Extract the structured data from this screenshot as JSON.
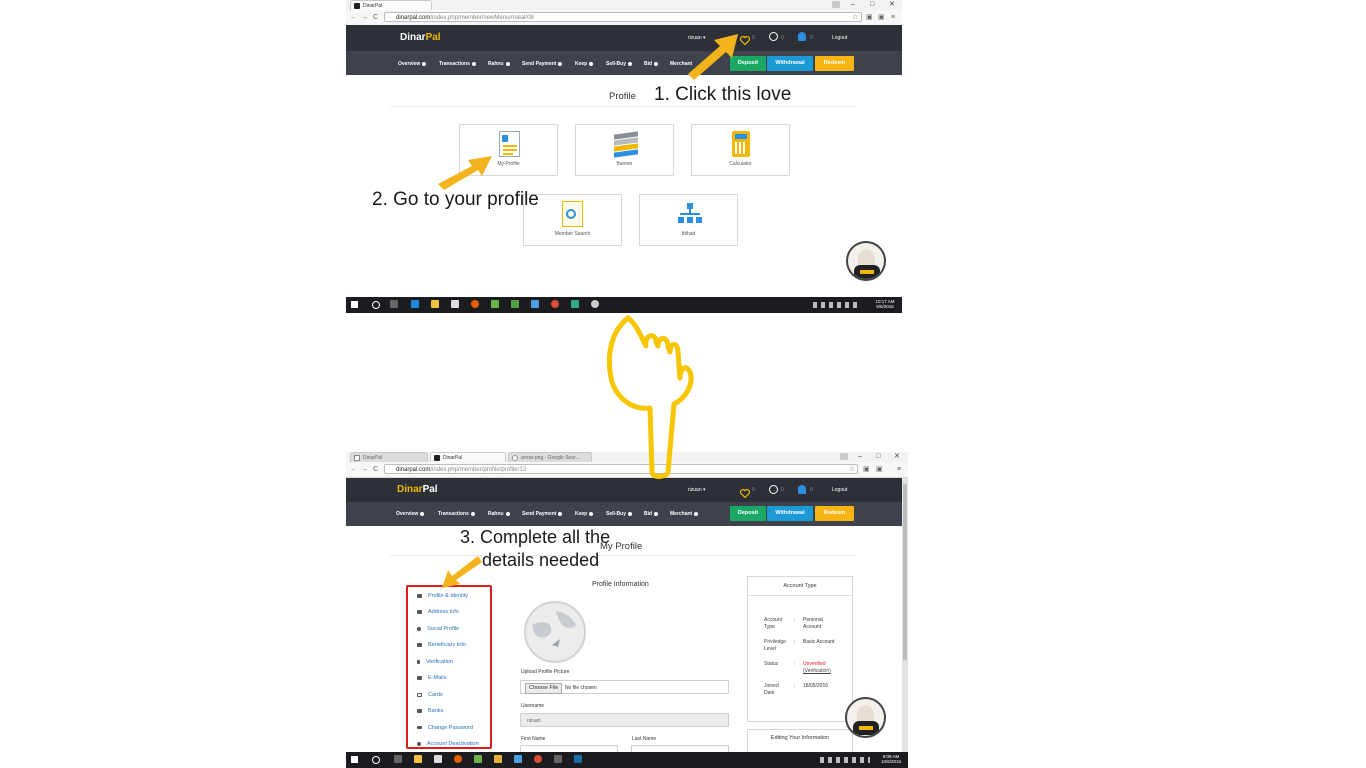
{
  "top": {
    "browser": {
      "tab_title": "DinarPal",
      "url_host": "dinarpal.com",
      "url_path": "/index.php/member/newMenu/malal/08",
      "window_controls": [
        "–",
        "□",
        "✕"
      ]
    },
    "header": {
      "logo_dinar": "Dinar",
      "logo_pal": "Pal",
      "user": "rizuan ▾",
      "love_count": "0",
      "globe_count": "0",
      "bell_count": "0",
      "logout": "Logout"
    },
    "menu": [
      "Overview",
      "Transactions",
      "Rahnu",
      "Send Payment",
      "Keep",
      "Sell-Buy",
      "Bid",
      "Merchant"
    ],
    "buttons": {
      "deposit": "Deposit",
      "withdrawal": "Withdrawal",
      "redeem": "Redeem"
    },
    "page_title": "Profile",
    "tiles": [
      "My Profile",
      "Banner",
      "Calculator",
      "Member Search",
      "Ittihad"
    ],
    "clock": {
      "time": "10:17 AM",
      "date": "9/6/2016"
    }
  },
  "annotations": {
    "step1": "1. Click this love",
    "step2": "2. Go to your profile",
    "step3_line1": "3. Complete all the",
    "step3_line2": "details needed"
  },
  "bottom": {
    "browser": {
      "tabs": [
        "DinarPal",
        "DinarPal",
        "arrow png - Google Sear..."
      ],
      "url_host": "dinarpal.com",
      "url_path": "/index.php/member/profile/profile/12"
    },
    "header": {
      "logo_dinar": "Dinar",
      "logo_pal": "Pal",
      "user": "rizuan ▾",
      "love_count": "0",
      "globe_count": "0",
      "bell_count": "0",
      "logout": "Logout"
    },
    "menu": [
      "Overview",
      "Transactions",
      "Rahnu",
      "Send Payment",
      "Keep",
      "Sell-Buy",
      "Bid",
      "Merchant"
    ],
    "buttons": {
      "deposit": "Deposit",
      "withdrawal": "Withdrawal",
      "redeem": "Redeem"
    },
    "page_title": "My Profile",
    "sidebar": [
      "Profile & Identity",
      "Address Info",
      "Social Profile",
      "Beneficiary Info",
      "Verification",
      "E-Mails",
      "Cards",
      "Banks",
      "Change Password",
      "Account Deactivation"
    ],
    "profile_info": {
      "title": "Profile Information",
      "upload_label": "Upload Profile Picture",
      "choose_file": "Choose File",
      "no_file": "No file chosen",
      "username_label": "Username",
      "username_value": "rizuan",
      "first_name_label": "First Name",
      "last_name_label": "Last Name"
    },
    "account_type": {
      "title": "Account Type",
      "rows": [
        {
          "key": "Account Type",
          "value": "Personal Account"
        },
        {
          "key": "Priviledge Level",
          "value": "Basic Account"
        },
        {
          "key": "Status",
          "value": "Unverified",
          "link": "(Verification)"
        },
        {
          "key": "Joined Date",
          "value": "18/05/2016"
        }
      ],
      "colon": ":"
    },
    "editing_title": "Editing Your Information",
    "clock": {
      "time": "9:09 AM",
      "date": "10/6/2016"
    }
  },
  "colors": {
    "accent": "#f0b800",
    "deposit": "#1aa864",
    "withdrawal": "#1b9ad6",
    "redeem": "#f7b514",
    "highlight": "#e01d1d",
    "arrow": "#f3b31c"
  }
}
